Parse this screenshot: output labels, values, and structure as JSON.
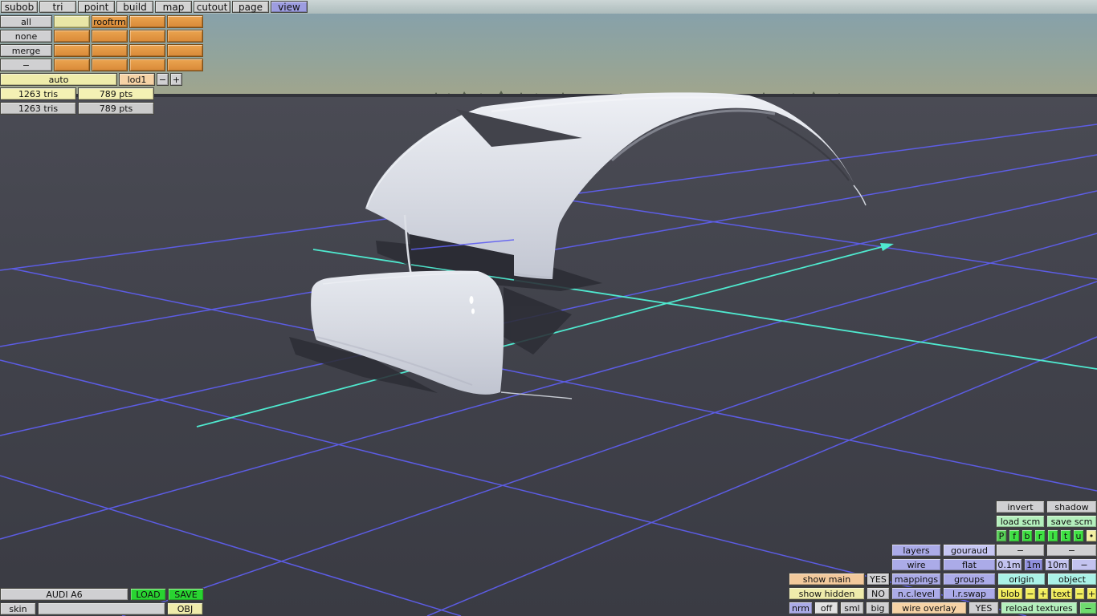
{
  "colors": {
    "active_tab": "#9d9de0",
    "orange_cell": "#e2953f",
    "selected_cell": "#e9e6a6",
    "axis_cyan": "#4fe9cf",
    "grid_blue": "#5f5ff2",
    "load_save_green": "#29d431",
    "panel_lavender": "#ababe8"
  },
  "menu": {
    "tabs": [
      "subob",
      "tri",
      "point",
      "build",
      "map",
      "cutout",
      "page",
      "view"
    ],
    "active_tab": "view"
  },
  "selection": {
    "buttons": {
      "all": "all",
      "none": "none",
      "merge": "merge",
      "dash": "−"
    },
    "cell_label": "rooftrm"
  },
  "lod": {
    "auto": "auto",
    "level": "lod1",
    "minus": "−",
    "plus": "+"
  },
  "stats": {
    "row1": {
      "tris": "1263 tris",
      "pts": "789 pts"
    },
    "row2": {
      "tris": "1263 tris",
      "pts": "789 pts"
    }
  },
  "file": {
    "name": "AUDI A6",
    "load": "LOAD",
    "save": "SAVE",
    "skin": "skin",
    "obj": "OBJ"
  },
  "panel": {
    "invert": "invert",
    "shadow": "shadow",
    "load_scm": "load scm",
    "save_scm": "save scm",
    "flags": [
      "P",
      "f",
      "b",
      "r",
      "l",
      "t",
      "u"
    ],
    "flag_dot": "•",
    "dash_a": "−",
    "dash_b": "−",
    "size_01": "0.1m",
    "size_1": "1m",
    "size_10": "10m",
    "size_dash": "−",
    "origin": "origin",
    "object": "object",
    "blob": "blob",
    "blob_minus": "−",
    "blob_plus": "+",
    "text": "text",
    "text_minus": "−",
    "text_plus": "+",
    "reload": "reload textures",
    "reload_dash": "−",
    "layers": "layers",
    "gouraud": "gouraud",
    "wire": "wire",
    "flat": "flat",
    "mappings": "mappings",
    "groups": "groups",
    "nc_level": "n.c.level",
    "lr_swap": "l.r.swap",
    "wire_overlay": "wire overlay",
    "wire_overlay_value": "YES",
    "show_main": "show main",
    "show_main_value": "YES",
    "show_hidden": "show hidden",
    "show_hidden_value": "NO",
    "nrm": "nrm",
    "off": "off",
    "sml": "sml",
    "big": "big"
  }
}
